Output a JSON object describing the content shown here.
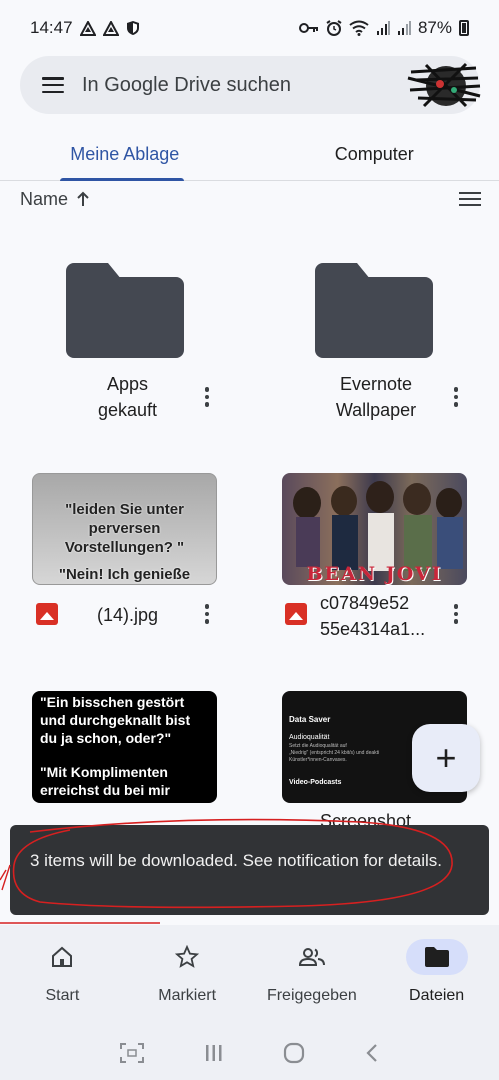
{
  "status_bar": {
    "time": "14:47",
    "battery_percent": "87%",
    "left_icons": [
      "drive-sync-icon",
      "drive-sync-icon",
      "shield-icon"
    ],
    "right_icons": [
      "key-icon",
      "alarm-icon",
      "wifi-icon",
      "signal-icon",
      "signal-icon",
      "battery-icon"
    ]
  },
  "search": {
    "placeholder": "In Google Drive suchen"
  },
  "tabs": [
    {
      "label": "Meine Ablage",
      "active": true
    },
    {
      "label": "Computer",
      "active": false
    }
  ],
  "sort": {
    "label": "Name",
    "direction_icon": "arrow-up-icon"
  },
  "items": [
    {
      "type": "folder",
      "name_line1": "Apps",
      "name_line2": "gekauft"
    },
    {
      "type": "folder",
      "name_line1": "Evernote",
      "name_line2": "Wallpaper"
    },
    {
      "type": "image",
      "name": "(14).jpg",
      "thumb_line1": "\"leiden Sie unter",
      "thumb_line2": "perversen",
      "thumb_line3": "Vorstellungen? \"",
      "thumb_line4": "\"Nein! Ich genieße"
    },
    {
      "type": "image",
      "name_line1": "c07849e52",
      "name_line2": "55e4314a1...",
      "thumb_caption": "BEAN JOVI"
    },
    {
      "type": "image",
      "name": "",
      "thumb_line1": "\"Ein bisschen gestört",
      "thumb_line2": "und durchgeknallt bist",
      "thumb_line3": "du ja schon, oder?\"",
      "thumb_line4": "\"Mit Komplimenten",
      "thumb_line5": "erreichst du bei mir"
    },
    {
      "type": "image",
      "name": "Screenshot",
      "thumb_title": "Data Saver",
      "thumb_sub": "Audioqualität",
      "thumb_desc1": "Setzt die Audioqualität auf",
      "thumb_desc2": "„Niedrig\" (entspricht 24 kbit/s) und deakti",
      "thumb_desc3": "Künstler*innen-Canvases.",
      "thumb_footer": "Video-Podcasts"
    }
  ],
  "snackbar": {
    "message": "3 items will be downloaded. See notification for details."
  },
  "bottom_nav": [
    {
      "label": "Start",
      "icon": "home-icon",
      "active": false
    },
    {
      "label": "Markiert",
      "icon": "star-icon",
      "active": false
    },
    {
      "label": "Freigegeben",
      "icon": "people-icon",
      "active": false
    },
    {
      "label": "Dateien",
      "icon": "folder-icon",
      "active": true
    }
  ],
  "colors": {
    "accent": "#2f55a4",
    "folder": "#444851",
    "snackbar": "#313336",
    "image_icon": "#d93025",
    "annotation_red": "#d62020"
  }
}
